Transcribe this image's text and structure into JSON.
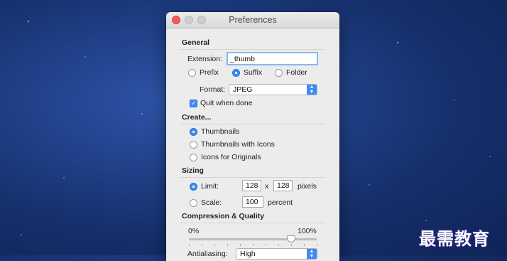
{
  "window": {
    "title": "Preferences"
  },
  "general": {
    "heading": "General",
    "extension_label": "Extension:",
    "extension_value": "_thumb",
    "position_options": [
      {
        "label": "Prefix",
        "selected": false
      },
      {
        "label": "Suffix",
        "selected": true
      },
      {
        "label": "Folder",
        "selected": false
      }
    ],
    "format_label": "Format:",
    "format_value": "JPEG",
    "quit_label": "Quit when done",
    "quit_checked": true
  },
  "create": {
    "heading": "Create...",
    "options": [
      {
        "label": "Thumbnails",
        "selected": true
      },
      {
        "label": "Thumbnails with Icons",
        "selected": false
      },
      {
        "label": "Icons for Originals",
        "selected": false
      }
    ]
  },
  "sizing": {
    "heading": "Sizing",
    "limit_label": "Limit:",
    "limit_selected": true,
    "limit_width": "128",
    "times": "x",
    "limit_height": "128",
    "pixels_label": "pixels",
    "scale_label": "Scale:",
    "scale_selected": false,
    "scale_value": "100",
    "percent_label": "percent"
  },
  "compression": {
    "heading": "Compression & Quality",
    "min_label": "0%",
    "max_label": "100%",
    "quality_fraction": 0.8,
    "antialiasing_label": "Antialiasing:",
    "antialiasing_value": "High"
  },
  "watermark": {
    "text": "最需教育"
  },
  "colors": {
    "accent": "#3d8cf2",
    "close": "#f25a55"
  }
}
